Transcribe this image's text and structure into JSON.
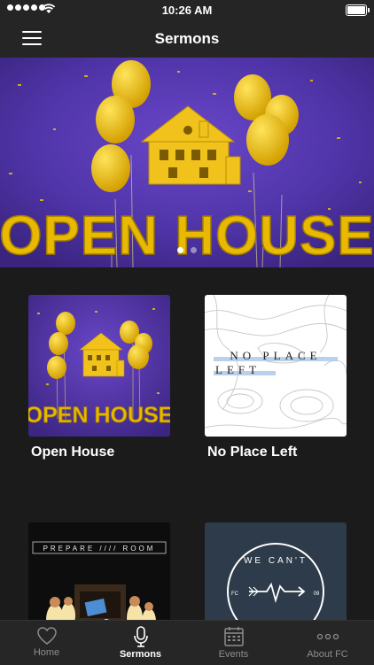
{
  "status": {
    "time": "10:26 AM"
  },
  "header": {
    "title": "Sermons"
  },
  "hero": {
    "banner_text": "OPEN HOUSE",
    "slide_count": 2,
    "active_slide": 1
  },
  "sermons": [
    {
      "title": "Open House",
      "art_text": "OPEN HOUSE"
    },
    {
      "title": "No Place Left",
      "art_text_line1": "NO PLACE",
      "art_text_line2": "LEFT"
    },
    {
      "art_text": "PREPARE //// ROOM"
    },
    {
      "art_text": "WE CAN'T",
      "art_text_left": "FC",
      "art_text_right": "09"
    }
  ],
  "tabs": [
    {
      "label": "Home",
      "icon": "heart-icon"
    },
    {
      "label": "Sermons",
      "icon": "microphone-icon",
      "active": true
    },
    {
      "label": "Events",
      "icon": "calendar-icon"
    },
    {
      "label": "About FC",
      "icon": "more-dots-icon"
    }
  ],
  "colors": {
    "bar": "#252525",
    "background": "#1b1b1b",
    "purple": "#5b3aa8",
    "gold": "#f0c000"
  }
}
